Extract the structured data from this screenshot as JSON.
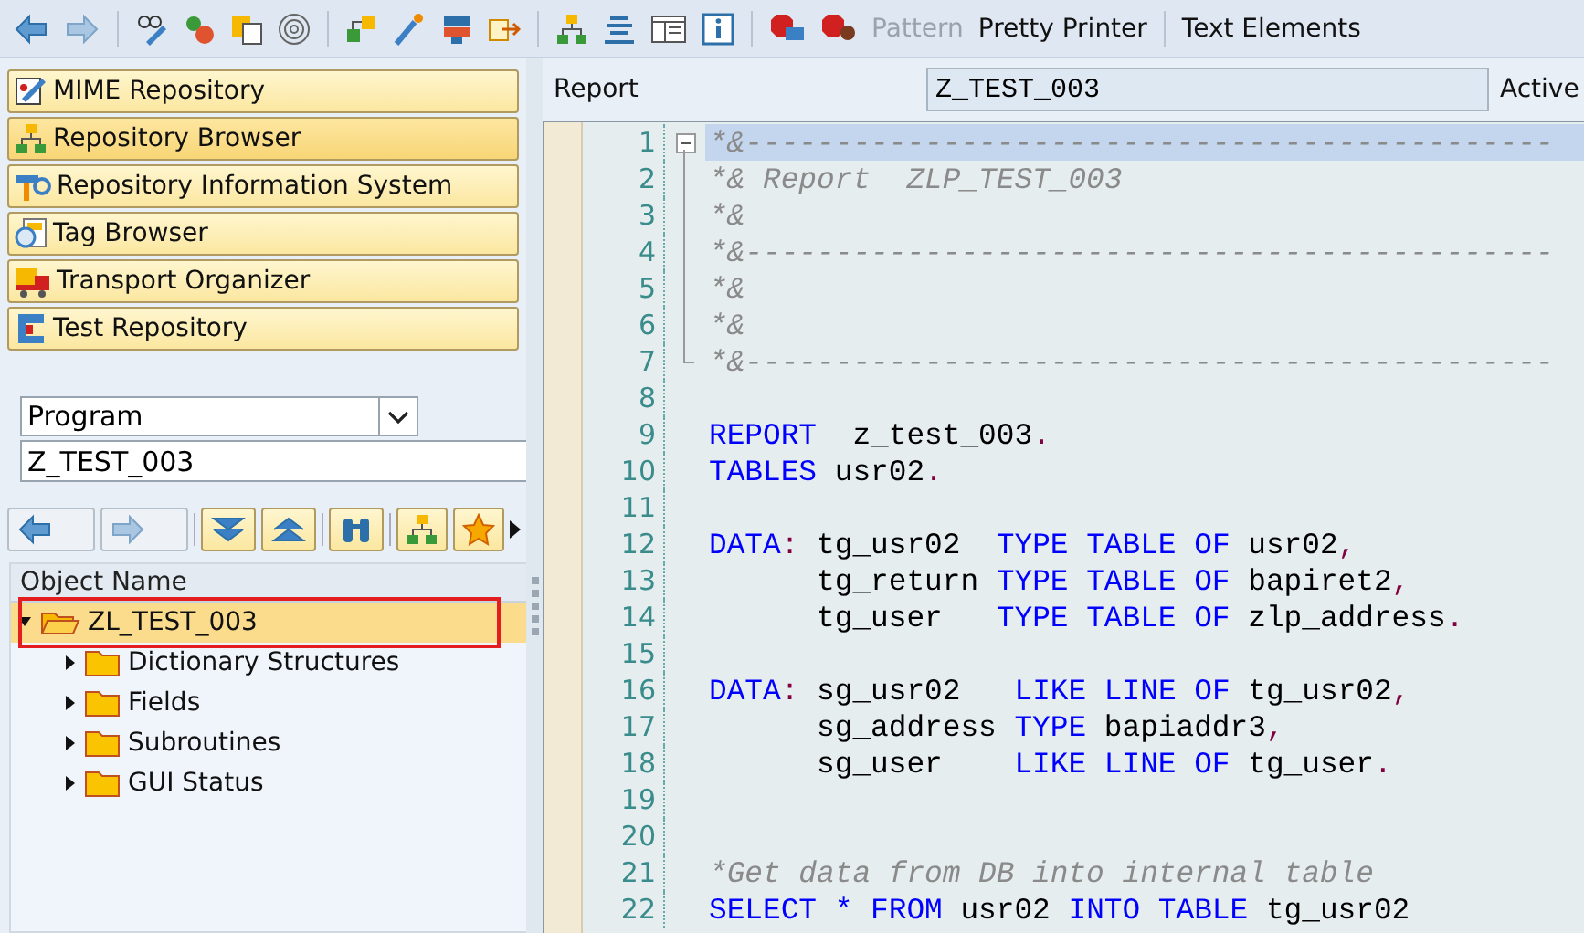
{
  "toolbar": {
    "buttons": [
      {
        "label": "Pattern",
        "disabled": true
      },
      {
        "label": "Pretty Printer",
        "disabled": false
      },
      {
        "label": "Text Elements",
        "disabled": false
      }
    ]
  },
  "navigator": {
    "buttons": [
      {
        "label": "MIME Repository",
        "selected": false
      },
      {
        "label": "Repository Browser",
        "selected": true
      },
      {
        "label": "Repository Information System",
        "selected": false
      },
      {
        "label": "Tag Browser",
        "selected": false
      },
      {
        "label": "Transport Organizer",
        "selected": false
      },
      {
        "label": "Test Repository",
        "selected": false
      }
    ],
    "object_type": "Program",
    "object_name": "Z_TEST_003"
  },
  "tree": {
    "column": "Object Name",
    "nodes": [
      {
        "label": "ZL_TEST_003",
        "expanded": true,
        "selected": true,
        "children": [
          {
            "label": "Dictionary Structures",
            "expanded": false,
            "selected": false
          },
          {
            "label": "Fields",
            "expanded": false,
            "selected": false
          },
          {
            "label": "Subroutines",
            "expanded": false,
            "selected": false
          },
          {
            "label": "GUI Status",
            "expanded": false,
            "selected": false
          }
        ]
      }
    ]
  },
  "editor": {
    "type_label": "Report",
    "program": "Z_TEST_003",
    "status": "Active",
    "lines": [
      {
        "number": "1",
        "current": true,
        "kind": "fold_start",
        "segments": [
          {
            "kind": "comment",
            "text": "*&---------------------------------------------"
          }
        ]
      },
      {
        "number": "2",
        "current": false,
        "kind": "fold_middle",
        "segments": [
          {
            "kind": "comment",
            "text": "*& Report  ZLP_TEST_003"
          }
        ]
      },
      {
        "number": "3",
        "current": false,
        "kind": "fold_middle",
        "segments": [
          {
            "kind": "comment",
            "text": "*&"
          }
        ]
      },
      {
        "number": "4",
        "current": false,
        "kind": "fold_middle",
        "segments": [
          {
            "kind": "comment",
            "text": "*&---------------------------------------------"
          }
        ]
      },
      {
        "number": "5",
        "current": false,
        "kind": "fold_middle",
        "segments": [
          {
            "kind": "comment",
            "text": "*&"
          }
        ]
      },
      {
        "number": "6",
        "current": false,
        "kind": "fold_middle",
        "segments": [
          {
            "kind": "comment",
            "text": "*&"
          }
        ]
      },
      {
        "number": "7",
        "current": false,
        "kind": "fold_end",
        "segments": [
          {
            "kind": "comment",
            "text": "*&---------------------------------------------"
          }
        ]
      },
      {
        "number": "8"
      },
      {
        "number": "9",
        "current": false,
        "segments": [
          {
            "kind": "keyword",
            "text": "REPORT"
          },
          {
            "kind": "ident",
            "text": "  z_test_003"
          },
          {
            "kind": "punct",
            "text": "."
          }
        ]
      },
      {
        "number": "10",
        "current": false,
        "segments": [
          {
            "kind": "keyword",
            "text": "TABLES"
          },
          {
            "kind": "ident",
            "text": " usr02"
          },
          {
            "kind": "punct",
            "text": "."
          }
        ]
      },
      {
        "number": "11"
      },
      {
        "number": "12",
        "current": false,
        "segments": [
          {
            "kind": "keyword",
            "text": "DATA"
          },
          {
            "kind": "punct",
            "text": ":"
          },
          {
            "kind": "ident",
            "text": " tg_usr02  "
          },
          {
            "kind": "keyword",
            "text": "TYPE TABLE OF"
          },
          {
            "kind": "ident",
            "text": " usr02"
          },
          {
            "kind": "punct",
            "text": ","
          }
        ]
      },
      {
        "number": "13",
        "current": false,
        "segments": [
          {
            "kind": "ident",
            "text": "      tg_return "
          },
          {
            "kind": "keyword",
            "text": "TYPE TABLE OF"
          },
          {
            "kind": "ident",
            "text": " bapiret2"
          },
          {
            "kind": "punct",
            "text": ","
          }
        ]
      },
      {
        "number": "14",
        "current": false,
        "segments": [
          {
            "kind": "ident",
            "text": "      tg_user   "
          },
          {
            "kind": "keyword",
            "text": "TYPE TABLE OF"
          },
          {
            "kind": "ident",
            "text": " zlp_address"
          },
          {
            "kind": "punct",
            "text": "."
          }
        ]
      },
      {
        "number": "15"
      },
      {
        "number": "16",
        "current": false,
        "segments": [
          {
            "kind": "keyword",
            "text": "DATA"
          },
          {
            "kind": "punct",
            "text": ":"
          },
          {
            "kind": "ident",
            "text": " sg_usr02   "
          },
          {
            "kind": "keyword",
            "text": "LIKE LINE OF"
          },
          {
            "kind": "ident",
            "text": " tg_usr02"
          },
          {
            "kind": "punct",
            "text": ","
          }
        ]
      },
      {
        "number": "17",
        "current": false,
        "segments": [
          {
            "kind": "ident",
            "text": "      sg_address "
          },
          {
            "kind": "keyword",
            "text": "TYPE"
          },
          {
            "kind": "ident",
            "text": " bapiaddr3"
          },
          {
            "kind": "punct",
            "text": ","
          }
        ]
      },
      {
        "number": "18",
        "current": false,
        "segments": [
          {
            "kind": "ident",
            "text": "      sg_user    "
          },
          {
            "kind": "keyword",
            "text": "LIKE LINE OF"
          },
          {
            "kind": "ident",
            "text": " tg_user"
          },
          {
            "kind": "punct",
            "text": "."
          }
        ]
      },
      {
        "number": "19"
      },
      {
        "number": "20"
      },
      {
        "number": "21",
        "current": false,
        "segments": [
          {
            "kind": "comment",
            "text": "*Get data from DB into internal table"
          }
        ]
      },
      {
        "number": "22",
        "current": false,
        "segments": [
          {
            "kind": "keyword",
            "text": "SELECT * FROM"
          },
          {
            "kind": "ident",
            "text": " usr02 "
          },
          {
            "kind": "keyword",
            "text": "INTO TABLE"
          },
          {
            "kind": "ident",
            "text": " tg_usr02"
          }
        ]
      }
    ]
  }
}
